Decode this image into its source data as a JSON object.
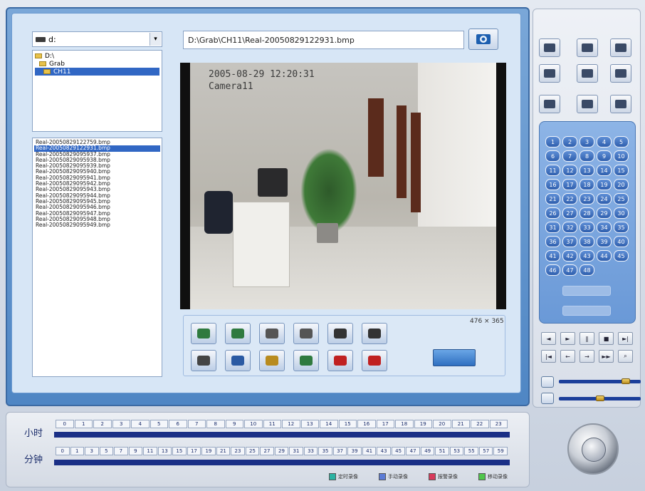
{
  "drive": {
    "label": "d:",
    "dropdown_glyph": "▾"
  },
  "folders": [
    {
      "label": "D:\\",
      "selected": false
    },
    {
      "label": "Grab",
      "selected": false
    },
    {
      "label": "CH11",
      "selected": true
    }
  ],
  "files": [
    "Real-20050829122759.bmp",
    "Real-20050829122931.bmp",
    "Real-20050829095937.bmp",
    "Real-20050829095938.bmp",
    "Real-20050829095939.bmp",
    "Real-20050829095940.bmp",
    "Real-20050829095941.bmp",
    "Real-20050829095942.bmp",
    "Real-20050829095943.bmp",
    "Real-20050829095944.bmp",
    "Real-20050829095945.bmp",
    "Real-20050829095946.bmp",
    "Real-20050829095947.bmp",
    "Real-20050829095948.bmp",
    "Real-20050829095949.bmp"
  ],
  "selected_file_index": 1,
  "path": {
    "value": "D:\\Grab\\CH11\\Real-20050829122931.bmp"
  },
  "video": {
    "timestamp": "2005-08-29 12:20:31",
    "camera": "Camera11"
  },
  "resolution": "476 × 365",
  "tool_buttons": [
    "zoom-in-icon",
    "zoom-out-icon",
    "brightness-up-icon",
    "brightness-down-icon",
    "contrast-up-icon",
    "contrast-down-icon",
    "color-icon",
    "rotate-icon",
    "print-icon",
    "search-icon",
    "delete-icon",
    "close-icon"
  ],
  "right_top_buttons": [
    "camera-icon",
    "picture-icon",
    "snapshot-icon",
    "monitor-icon",
    "record-icon",
    "stop-record-icon",
    "network-icon",
    "storage-icon",
    "disk-icon"
  ],
  "channels": [
    "1",
    "2",
    "3",
    "4",
    "5",
    "6",
    "7",
    "8",
    "9",
    "10",
    "11",
    "12",
    "13",
    "14",
    "15",
    "16",
    "17",
    "18",
    "19",
    "20",
    "21",
    "22",
    "23",
    "24",
    "25",
    "26",
    "27",
    "28",
    "29",
    "30",
    "31",
    "32",
    "33",
    "34",
    "35",
    "36",
    "37",
    "38",
    "39",
    "40",
    "41",
    "42",
    "43",
    "44",
    "45",
    "46",
    "47",
    "48"
  ],
  "playback_buttons": [
    {
      "glyph": "◄",
      "name": "prev-icon"
    },
    {
      "glyph": "►",
      "name": "play-icon"
    },
    {
      "glyph": "‖",
      "name": "pause-icon"
    },
    {
      "glyph": "■",
      "name": "stop-icon"
    },
    {
      "glyph": "►|",
      "name": "next-icon"
    },
    {
      "glyph": "|◄",
      "name": "rewind-icon"
    },
    {
      "glyph": "←",
      "name": "step-back-icon"
    },
    {
      "glyph": "→",
      "name": "step-forward-icon"
    },
    {
      "glyph": "►►",
      "name": "fast-forward-icon"
    },
    {
      "glyph": "⌕",
      "name": "search-icon"
    }
  ],
  "sliders": {
    "volume_level": 0.85,
    "brightness_level": 0.5
  },
  "timeline": {
    "hour_label": "小时",
    "minute_label": "分钟",
    "hours": [
      "0",
      "1",
      "2",
      "3",
      "4",
      "5",
      "6",
      "7",
      "8",
      "9",
      "10",
      "11",
      "12",
      "13",
      "14",
      "15",
      "16",
      "17",
      "18",
      "19",
      "20",
      "21",
      "22",
      "23"
    ],
    "minutes": [
      "0",
      "1",
      "3",
      "5",
      "7",
      "9",
      "11",
      "13",
      "15",
      "17",
      "19",
      "21",
      "23",
      "25",
      "27",
      "29",
      "31",
      "33",
      "35",
      "37",
      "39",
      "41",
      "43",
      "45",
      "47",
      "49",
      "51",
      "53",
      "55",
      "57",
      "59"
    ]
  },
  "legend": [
    {
      "label": "定时录像",
      "color": "#2bb3a3"
    },
    {
      "label": "手动录像",
      "color": "#5b7bd6"
    },
    {
      "label": "报警录像",
      "color": "#d83a5b"
    },
    {
      "label": "移动录像",
      "color": "#4fc64b"
    }
  ]
}
